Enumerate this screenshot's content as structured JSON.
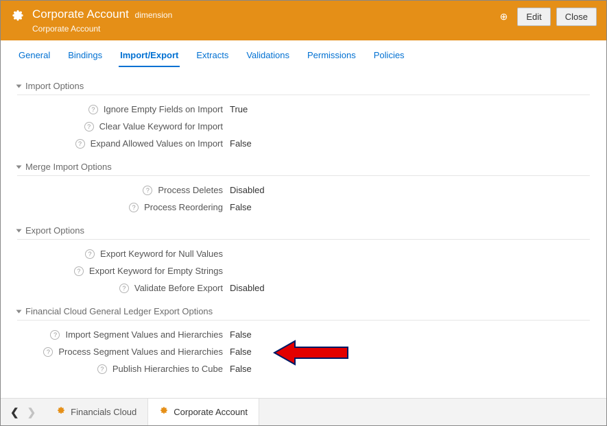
{
  "header": {
    "title": "Corporate Account",
    "type_suffix": "dimension",
    "subtitle": "Corporate Account",
    "edit_label": "Edit",
    "close_label": "Close"
  },
  "tabs": [
    {
      "label": "General",
      "active": false
    },
    {
      "label": "Bindings",
      "active": false
    },
    {
      "label": "Import/Export",
      "active": true
    },
    {
      "label": "Extracts",
      "active": false
    },
    {
      "label": "Validations",
      "active": false
    },
    {
      "label": "Permissions",
      "active": false
    },
    {
      "label": "Policies",
      "active": false
    }
  ],
  "sections": {
    "import_options": {
      "title": "Import Options",
      "rows": {
        "ignore_empty": {
          "label": "Ignore Empty Fields on Import",
          "value": "True"
        },
        "clear_value": {
          "label": "Clear Value Keyword for Import",
          "value": ""
        },
        "expand_allowed": {
          "label": "Expand Allowed Values on Import",
          "value": "False"
        }
      }
    },
    "merge_import_options": {
      "title": "Merge Import Options",
      "rows": {
        "process_deletes": {
          "label": "Process Deletes",
          "value": "Disabled"
        },
        "process_reordering": {
          "label": "Process Reordering",
          "value": "False"
        }
      }
    },
    "export_options": {
      "title": "Export Options",
      "rows": {
        "null_keyword": {
          "label": "Export Keyword for Null Values",
          "value": ""
        },
        "empty_keyword": {
          "label": "Export Keyword for Empty Strings",
          "value": ""
        },
        "validate_before": {
          "label": "Validate Before Export",
          "value": "Disabled"
        }
      }
    },
    "fcgl_export_options": {
      "title": "Financial Cloud General Ledger Export Options",
      "rows": {
        "import_segment": {
          "label": "Import Segment Values and Hierarchies",
          "value": "False"
        },
        "process_segment": {
          "label": "Process Segment Values and Hierarchies",
          "value": "False"
        },
        "publish_cube": {
          "label": "Publish Hierarchies to Cube",
          "value": "False"
        }
      }
    }
  },
  "breadcrumb": {
    "items": [
      {
        "label": "Financials Cloud",
        "active": false
      },
      {
        "label": "Corporate Account",
        "active": true
      }
    ]
  }
}
